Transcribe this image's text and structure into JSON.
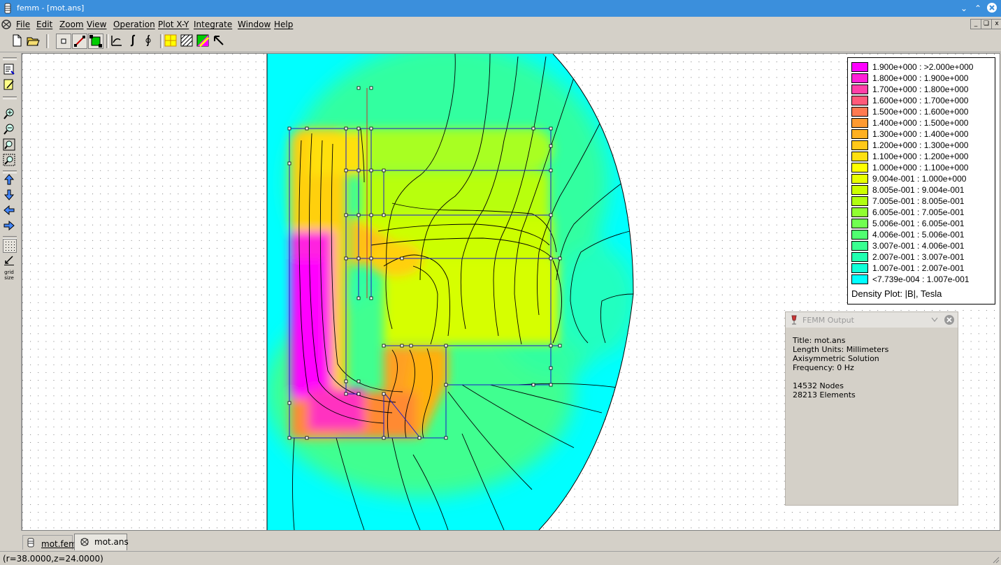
{
  "window": {
    "title": "femm - [mot.ans]"
  },
  "menu": [
    "File",
    "Edit",
    "Zoom",
    "View",
    "Operation",
    "Plot X-Y",
    "Integrate",
    "Window",
    "Help"
  ],
  "legend": {
    "title": "Density Plot:  |B|, Tesla",
    "rows": [
      {
        "range": "1.900e+000 : >2.000e+000",
        "color": "#ff00ff"
      },
      {
        "range": "1.800e+000 : 1.900e+000",
        "color": "#ff20d8"
      },
      {
        "range": "1.700e+000 : 1.800e+000",
        "color": "#ff40a8"
      },
      {
        "range": "1.600e+000 : 1.700e+000",
        "color": "#ff5a7a"
      },
      {
        "range": "1.500e+000 : 1.600e+000",
        "color": "#ff7a50"
      },
      {
        "range": "1.400e+000 : 1.500e+000",
        "color": "#ff9a30"
      },
      {
        "range": "1.300e+000 : 1.400e+000",
        "color": "#ffb020"
      },
      {
        "range": "1.200e+000 : 1.300e+000",
        "color": "#ffc818"
      },
      {
        "range": "1.100e+000 : 1.200e+000",
        "color": "#ffe010"
      },
      {
        "range": "1.000e+000 : 1.100e+000",
        "color": "#ffff00"
      },
      {
        "range": "9.004e-001 : 1.000e+000",
        "color": "#e8ff00"
      },
      {
        "range": "8.005e-001 : 9.004e-001",
        "color": "#ccff00"
      },
      {
        "range": "7.005e-001 : 8.005e-001",
        "color": "#b0ff10"
      },
      {
        "range": "6.005e-001 : 7.005e-001",
        "color": "#90ff30"
      },
      {
        "range": "5.006e-001 : 6.005e-001",
        "color": "#70ff50"
      },
      {
        "range": "4.006e-001 : 5.006e-001",
        "color": "#50ff70"
      },
      {
        "range": "3.007e-001 : 4.006e-001",
        "color": "#38ff90"
      },
      {
        "range": "2.007e-001 : 3.007e-001",
        "color": "#20ffb0"
      },
      {
        "range": "1.007e-001 : 2.007e-001",
        "color": "#10ffd8"
      },
      {
        "range": "<7.739e-004 : 1.007e-001",
        "color": "#00ffff"
      }
    ]
  },
  "output": {
    "title": "FEMM Output",
    "lines": [
      "Title: mot.ans",
      "Length Units: Millimeters",
      "Axisymmetric Solution",
      "Frequency: 0 Hz",
      "",
      "14532 Nodes",
      "28213 Elements"
    ]
  },
  "tabs": [
    {
      "label": "mot.fem"
    },
    {
      "label": "mot.ans"
    }
  ],
  "status": "(r=38.0000,z=24.0000)"
}
